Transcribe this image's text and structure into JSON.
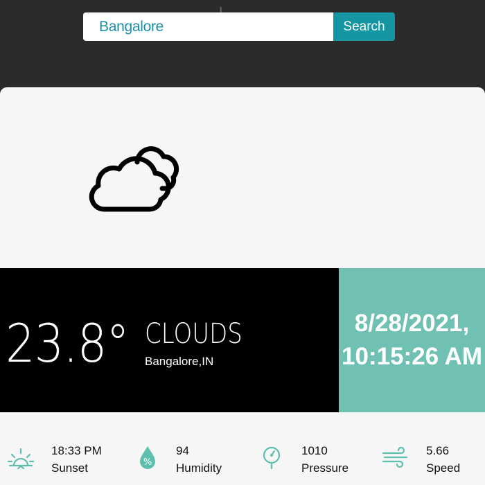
{
  "search": {
    "value": "Bangalore",
    "button_label": "Search"
  },
  "weather": {
    "icon": "clouds-icon",
    "temperature": "23.8°",
    "condition": "CLOUDS",
    "location": "Bangalore,IN"
  },
  "datetime": {
    "date": "8/28/2021,",
    "time": "10:15:26 AM"
  },
  "stats": [
    {
      "icon": "sunset-icon",
      "value": "18:33 PM",
      "label": "Sunset"
    },
    {
      "icon": "humidity-icon",
      "value": "94",
      "label": "Humidity"
    },
    {
      "icon": "pressure-icon",
      "value": "1010",
      "label": "Pressure"
    },
    {
      "icon": "wind-icon",
      "value": "5.66",
      "label": "Speed"
    }
  ],
  "colors": {
    "accent": "#1696a3",
    "teal_panel": "#70c1b3",
    "icon_teal": "#5fbfae"
  }
}
